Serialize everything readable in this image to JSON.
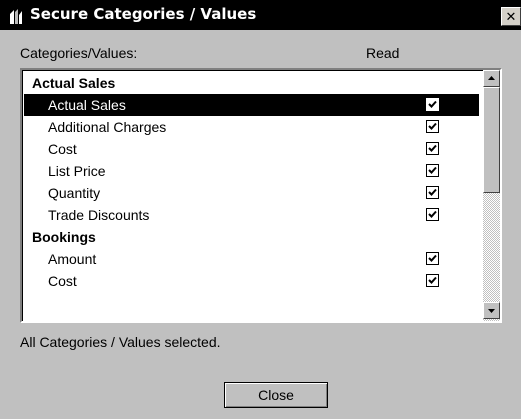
{
  "window": {
    "title": "Secure Categories / Values",
    "close_glyph": "✕",
    "icon": "app-icon"
  },
  "columns": {
    "name_header": "Categories/Values:",
    "read_header": "Read"
  },
  "list": {
    "rows": [
      {
        "type": "category",
        "label": "Actual Sales"
      },
      {
        "type": "value",
        "label": "Actual Sales",
        "read": true,
        "selected": true
      },
      {
        "type": "value",
        "label": "Additional Charges",
        "read": true
      },
      {
        "type": "value",
        "label": "Cost",
        "read": true
      },
      {
        "type": "value",
        "label": "List Price",
        "read": true
      },
      {
        "type": "value",
        "label": "Quantity",
        "read": true
      },
      {
        "type": "value",
        "label": "Trade Discounts",
        "read": true
      },
      {
        "type": "category",
        "label": "Bookings"
      },
      {
        "type": "value",
        "label": "Amount",
        "read": true
      },
      {
        "type": "value",
        "label": "Cost",
        "read": true
      }
    ]
  },
  "status_text": "All Categories / Values selected.",
  "buttons": {
    "close_label": "Close"
  },
  "colors": {
    "titlebar": "#000000",
    "dialog_bg": "#c0c0c0",
    "selection": "#000000"
  }
}
